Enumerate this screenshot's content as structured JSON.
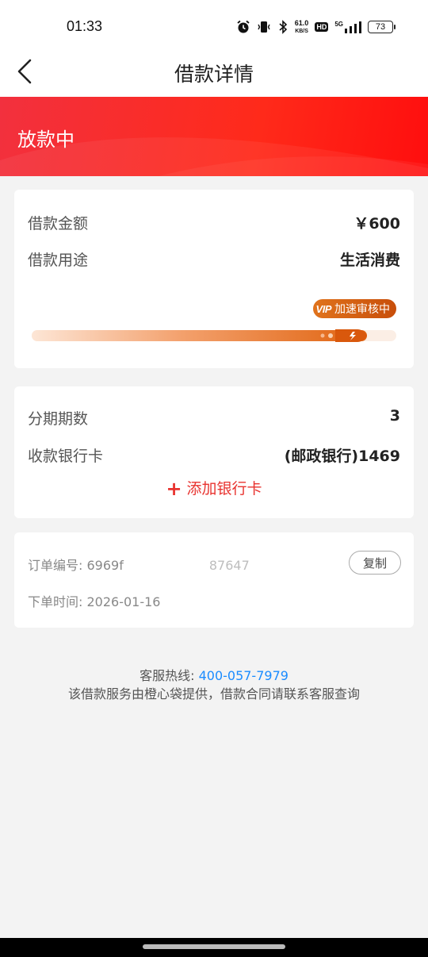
{
  "status_bar": {
    "time": "01:33",
    "net_speed_value": "61.0",
    "net_speed_unit": "KB/S",
    "hd": "HD",
    "network": "5G",
    "battery": "73",
    "icons": [
      "alarm-icon",
      "vibrate-icon",
      "bluetooth-icon",
      "signal-icon"
    ]
  },
  "nav": {
    "title": "借款详情",
    "back_icon": "chevron-left-icon"
  },
  "hero": {
    "status": "放款中",
    "color": "#ff1f1f"
  },
  "loan_card": {
    "amount_label": "借款金额",
    "amount_value": "￥600",
    "purpose_label": "借款用途",
    "purpose_value": "生活消费",
    "vip_mark": "VIP",
    "vip_text": "加速审核中",
    "progress": 0.92,
    "accent": "#e0630f"
  },
  "installment_card": {
    "periods_label": "分期期数",
    "periods_value": "3",
    "bank_label": "收款银行卡",
    "bank_value": "(邮政银行)1469",
    "add_card_label": "添加银行卡",
    "accent": "#e8332f"
  },
  "order_card": {
    "order_no_label": "订单编号:",
    "order_no_prefix": "6969f",
    "order_no_suffix": "87647",
    "copy_label": "复制",
    "order_time_label": "下单时间:",
    "order_time_value": "2026-01-16"
  },
  "footer": {
    "hotline_label": "客服热线:",
    "hotline_number": "400-057-7979",
    "hotline_color": "#1b8cff",
    "notice": "该借款服务由橙心袋提供，借款合同请联系客服查询"
  }
}
